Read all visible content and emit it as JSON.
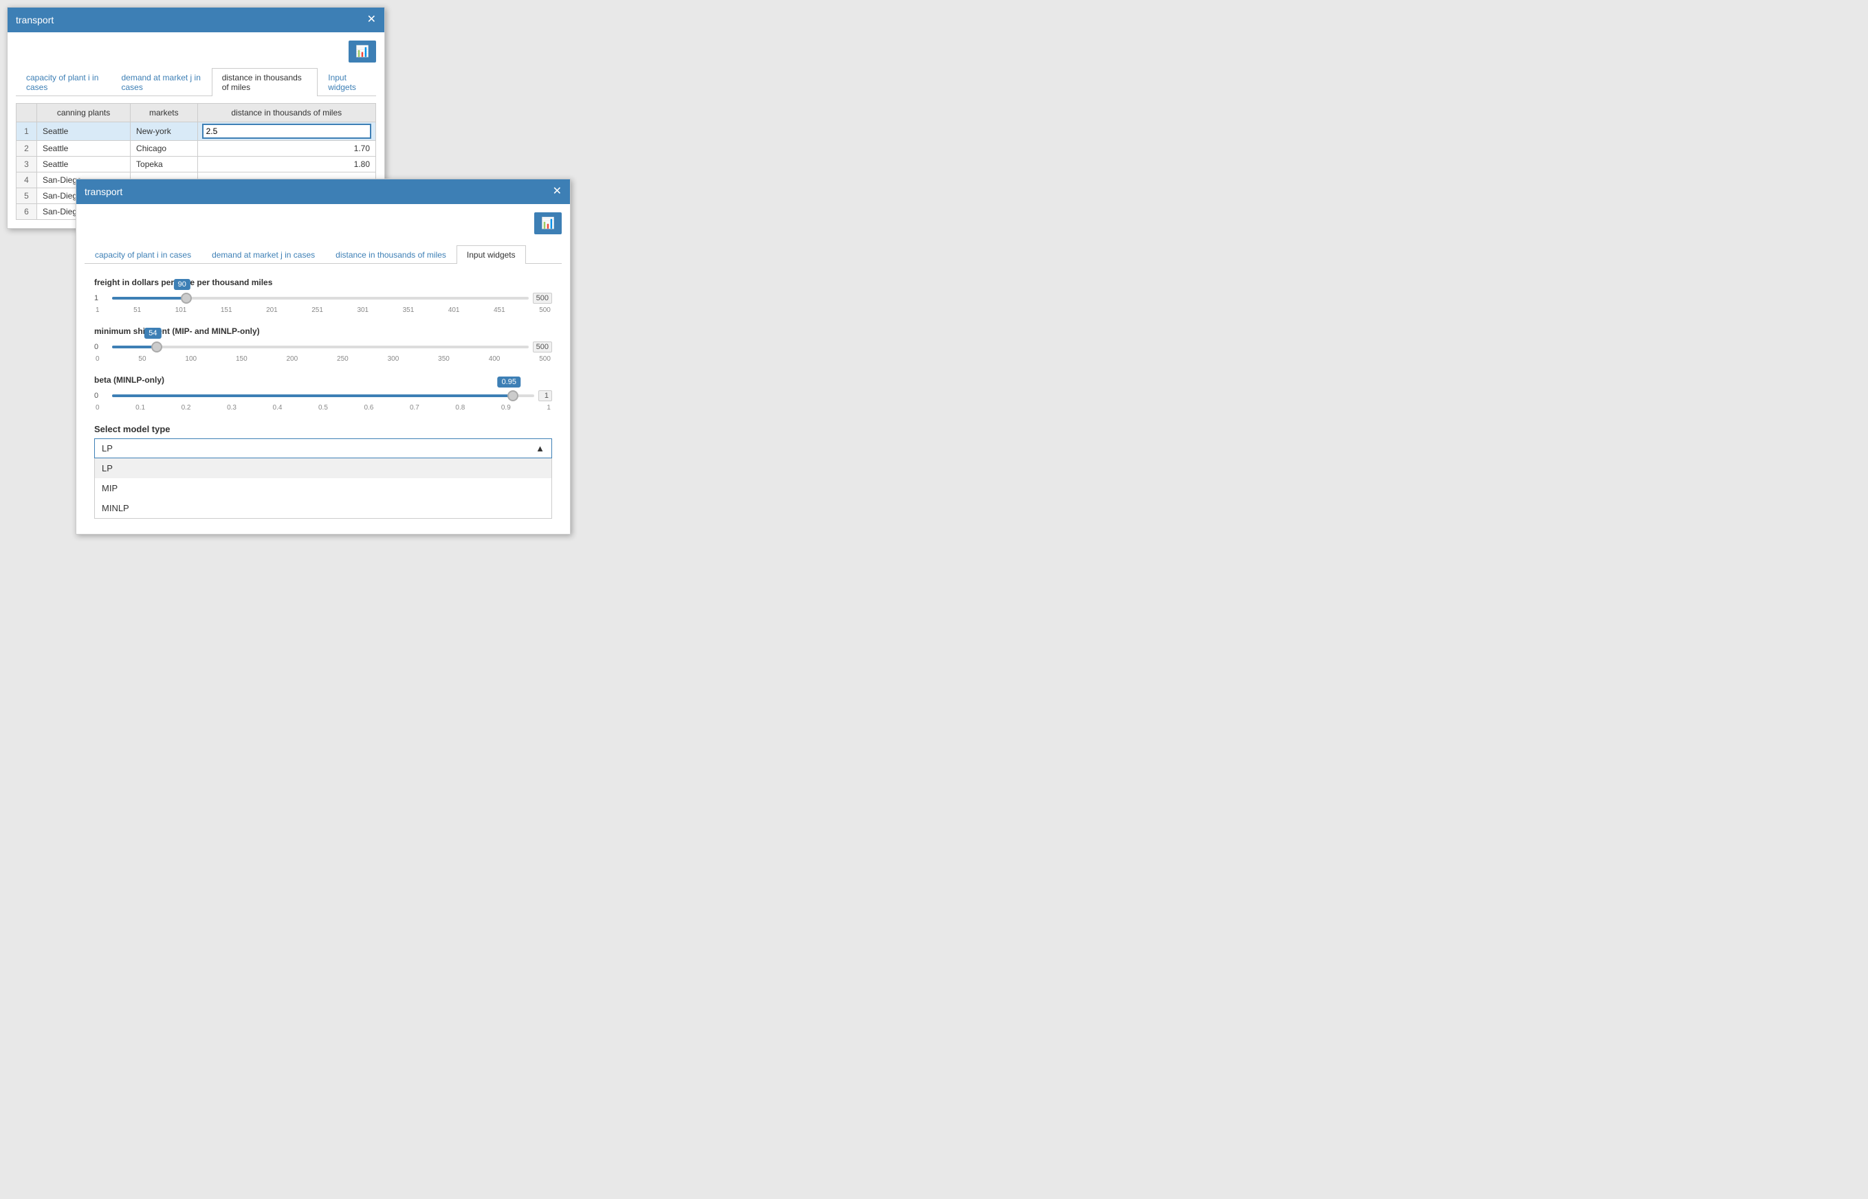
{
  "window1": {
    "title": "transport",
    "tabs": [
      {
        "id": "cap",
        "label": "capacity of plant i in cases",
        "active": false
      },
      {
        "id": "dem",
        "label": "demand at market j in cases",
        "active": false
      },
      {
        "id": "dist",
        "label": "distance in thousands of miles",
        "active": true
      },
      {
        "id": "inp",
        "label": "Input widgets",
        "active": false
      }
    ],
    "table": {
      "columns": [
        "canning plants",
        "markets",
        "distance in thousands of miles"
      ],
      "rows": [
        {
          "num": 1,
          "plant": "Seattle",
          "market": "New-york",
          "value": "2.5",
          "editing": true
        },
        {
          "num": 2,
          "plant": "Seattle",
          "market": "Chicago",
          "value": "1.70",
          "editing": false
        },
        {
          "num": 3,
          "plant": "Seattle",
          "market": "Topeka",
          "value": "1.80",
          "editing": false
        },
        {
          "num": 4,
          "plant": "San-Diego",
          "market": "",
          "value": "",
          "editing": false
        },
        {
          "num": 5,
          "plant": "San-Diego",
          "market": "",
          "value": "",
          "editing": false
        },
        {
          "num": 6,
          "plant": "San-Diego",
          "market": "",
          "value": "",
          "editing": false
        }
      ]
    }
  },
  "window2": {
    "title": "transport",
    "tabs": [
      {
        "id": "cap",
        "label": "capacity of plant i in cases",
        "active": false
      },
      {
        "id": "dem",
        "label": "demand at market j in cases",
        "active": false
      },
      {
        "id": "dist",
        "label": "distance in thousands of miles",
        "active": false
      },
      {
        "id": "inp",
        "label": "Input widgets",
        "active": true
      }
    ],
    "freight": {
      "label": "freight in dollars per case per thousand miles",
      "min": 1,
      "max": 500,
      "value": 90,
      "pct": 17.8,
      "ticks": [
        "1",
        "51",
        "101",
        "151",
        "201",
        "251",
        "301",
        "351",
        "401",
        "451",
        "500"
      ]
    },
    "minship": {
      "label": "minimum shipment (MIP- and MINLP-only)",
      "min": 0,
      "max": 500,
      "value": 54,
      "pct": 10.8,
      "ticks": [
        "0",
        "50",
        "100",
        "150",
        "200",
        "250",
        "300",
        "350",
        "400",
        "500"
      ]
    },
    "beta": {
      "label": "beta (MINLP-only)",
      "min": 0,
      "max": 1,
      "value": 0.95,
      "pct": 95,
      "ticks": [
        "0",
        "0.1",
        "0.2",
        "0.3",
        "0.4",
        "0.5",
        "0.6",
        "0.7",
        "0.8",
        "0.9",
        "1"
      ]
    },
    "select": {
      "label": "Select model type",
      "current": "LP",
      "options": [
        "LP",
        "MIP",
        "MINLP"
      ]
    }
  }
}
